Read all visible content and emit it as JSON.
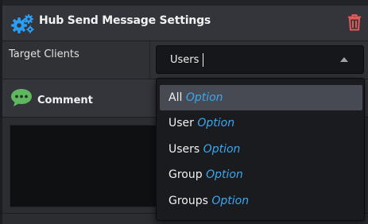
{
  "header": {
    "title": "Hub Send Message Settings",
    "gear_icon": "gears-icon",
    "delete_icon": "trash-icon",
    "accent": "#2a9df4",
    "delete_color": "#e15a5a"
  },
  "target_clients": {
    "label": "Target Clients",
    "value": "Users"
  },
  "comment": {
    "title": "Comment",
    "icon": "speech-bubble-icon",
    "icon_color": "#5fb85f"
  },
  "dropdown": {
    "highlighted_index": 0,
    "options": [
      {
        "name": "All",
        "kind": "Option"
      },
      {
        "name": "User",
        "kind": "Option"
      },
      {
        "name": "Users",
        "kind": "Option"
      },
      {
        "name": "Group",
        "kind": "Option"
      },
      {
        "name": "Groups",
        "kind": "Option"
      }
    ]
  }
}
